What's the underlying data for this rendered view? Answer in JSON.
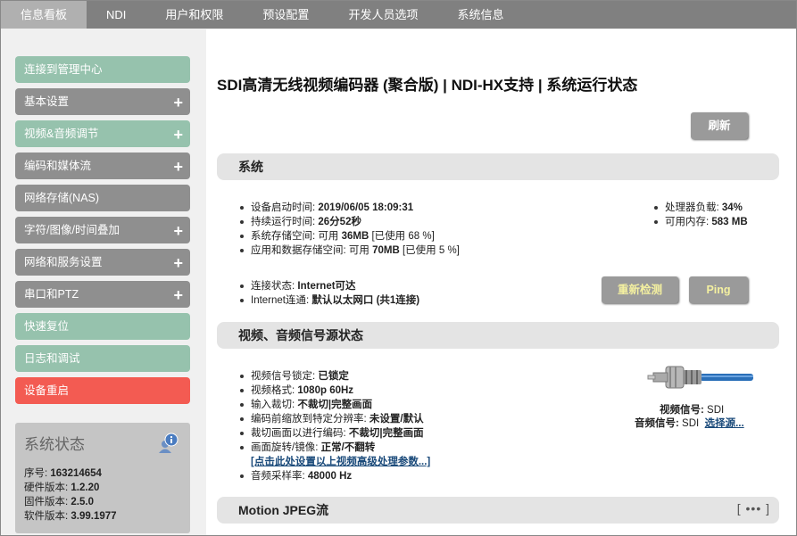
{
  "nav": {
    "tabs": [
      "信息看板",
      "NDI",
      "用户和权限",
      "预设配置",
      "开发人员选项",
      "系统信息"
    ],
    "active": 0
  },
  "sidebar": {
    "items": [
      {
        "label": "连接到管理中心",
        "color": "green",
        "plus": false
      },
      {
        "label": "基本设置",
        "color": "gray",
        "plus": true
      },
      {
        "label": "视频&音频调节",
        "color": "green",
        "plus": true
      },
      {
        "label": "编码和媒体流",
        "color": "gray",
        "plus": true
      },
      {
        "label": "网络存储(NAS)",
        "color": "gray",
        "plus": false
      },
      {
        "label": "字符/图像/时间叠加",
        "color": "gray",
        "plus": true
      },
      {
        "label": "网络和服务设置",
        "color": "gray",
        "plus": true
      },
      {
        "label": "串口和PTZ",
        "color": "gray",
        "plus": true
      },
      {
        "label": "快速复位",
        "color": "green",
        "plus": false
      },
      {
        "label": "日志和调试",
        "color": "green",
        "plus": false
      },
      {
        "label": "设备重启",
        "color": "red",
        "plus": false
      }
    ],
    "plus_glyph": "+"
  },
  "status_box": {
    "title": "系统状态",
    "rows": [
      {
        "label": "序号: ",
        "value": "163214654"
      },
      {
        "label": "硬件版本: ",
        "value": "1.2.20"
      },
      {
        "label": "固件版本: ",
        "value": "2.5.0"
      },
      {
        "label": "软件版本: ",
        "value": "3.99.1977"
      }
    ]
  },
  "main": {
    "title": "SDI高清无线视频编码器 (聚合版) | NDI-HX支持 | 系统运行状态",
    "refresh_label": "刷新",
    "system": {
      "header": "系统",
      "items": [
        {
          "label": "设备启动时间: ",
          "value": "2019/06/05 18:09:31",
          "suffix": ""
        },
        {
          "label": "持续运行时间: ",
          "value": "26分52秒",
          "suffix": ""
        },
        {
          "label": "系统存储空间: 可用 ",
          "value": "36MB",
          "suffix": " [已使用 68 %]"
        },
        {
          "label": "应用和数据存储空间: 可用 ",
          "value": "70MB",
          "suffix": " [已使用 5 %]"
        }
      ],
      "right_items": [
        {
          "label": "处理器负载: ",
          "value": "34%"
        },
        {
          "label": "可用内存: ",
          "value": "583 MB"
        }
      ],
      "conn_items": [
        {
          "label": "连接状态: ",
          "value": "Internet可达"
        },
        {
          "label": "Internet连通: ",
          "value": "默认以太网口 (共1连接)"
        }
      ],
      "recheck_label": "重新检测",
      "ping_label": "Ping"
    },
    "av": {
      "header": "视频、音频信号源状态",
      "items": [
        {
          "label": "视频信号锁定: ",
          "value": "已锁定"
        },
        {
          "label": "视频格式: ",
          "value": "1080p 60Hz"
        },
        {
          "label": "输入裁切: ",
          "value": "不裁切|完整画面"
        },
        {
          "label": "编码前缩放到特定分辨率: ",
          "value": "未设置/默认"
        },
        {
          "label": "裁切画面以进行编码: ",
          "value": "不裁切|完整画面"
        },
        {
          "label": "画面旋转/镜像: ",
          "value": "正常/不翻转"
        }
      ],
      "advanced_link": "[点击此处设置以上视频高级处理参数...]",
      "audio_rate": {
        "label": "音频采样率: ",
        "value": "48000 Hz"
      },
      "video_signal": {
        "label": "视频信号: ",
        "value": "SDI"
      },
      "audio_signal": {
        "label": "音频信号: ",
        "value": "SDI"
      },
      "select_source": "选择源..."
    },
    "mjpeg": {
      "header": "Motion JPEG流",
      "more": "[ ••• ]"
    }
  }
}
